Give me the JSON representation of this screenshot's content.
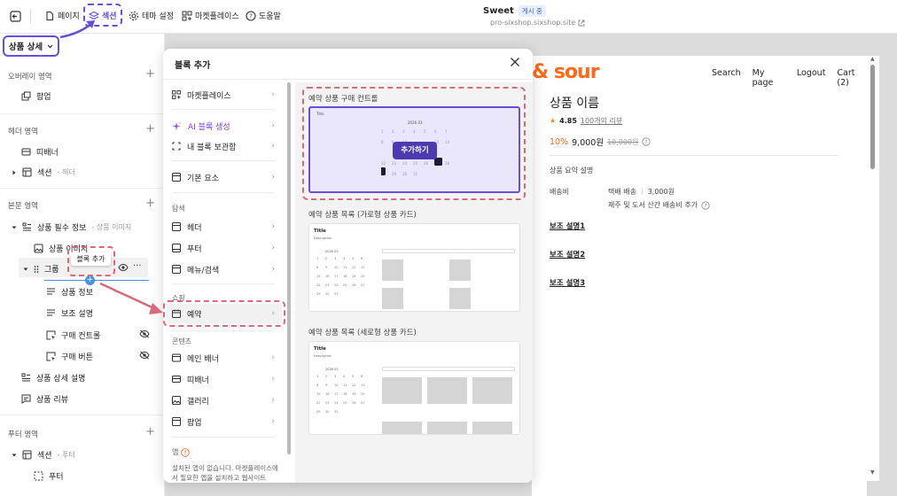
{
  "topbar": {
    "page_label": "페이지",
    "section_label": "섹션",
    "theme_label": "테마 설정",
    "market_label": "마켓플레이스",
    "help_label": "도움말",
    "site_name": "Sweet",
    "site_status": "게시 중",
    "site_url": "pro-sixshop.sixshop.site"
  },
  "page_select": "상품 상세",
  "sidebar": {
    "overlay": {
      "title": "오버레이 영역",
      "items": [
        "팝업"
      ]
    },
    "header": {
      "title": "헤더 영역",
      "ribbon": "띠배너",
      "section": "섹션",
      "section_sub": "- 헤더"
    },
    "body": {
      "title": "본문 영역",
      "product_info": "상품 필수 정보",
      "product_info_sub": "- 상품 이미지",
      "product_image": "상품 이미지",
      "group": "그룹",
      "product_info2": "상품 정보",
      "sub_desc": "보조 설명",
      "buy_control": "구매 컨트롤",
      "buy_button": "구매 버튼",
      "detail_desc": "상품 상세 설명",
      "review": "상품 리뷰"
    },
    "footer": {
      "title": "푸터 영역",
      "section": "섹션",
      "section_sub": "- 푸터",
      "footer": "푸터"
    },
    "tooltip": "블록 추가"
  },
  "modal": {
    "title": "블록 추가",
    "menu": {
      "market": "마켓플레이스",
      "ai": "AI 블록 생성",
      "storage": "내 블록 보관함",
      "basic": "기본 요소",
      "cat_nav": "탐색",
      "header": "헤더",
      "footer": "푸터",
      "menu_search": "메뉴/검색",
      "cat_shop": "쇼핑",
      "reserve": "예약",
      "cat_content": "콘텐츠",
      "main_banner": "메인 배너",
      "ribbon": "띠배너",
      "gallery": "갤러리",
      "popup": "팝업",
      "cat_app": "앱",
      "app_note": "설치된 앱이 없습니다. 마켓플레이스에서 필요한 앱을 설치하고 웹사이트"
    },
    "previews": [
      {
        "title": "예약 상품 구매 컨트롤",
        "button": "추가하기",
        "month": "2026.03",
        "label": "Title"
      },
      {
        "title": "예약 상품 목록 (가로형 상품 카드)",
        "card_title": "Title",
        "card_desc": "Description",
        "month": "2026.03"
      },
      {
        "title": "예약 상품 목록 (세로형 상품 카드)",
        "card_title": "Title",
        "card_desc": "Description",
        "month": "2026.03"
      }
    ]
  },
  "shop": {
    "logo": "& sour",
    "nav": [
      "Search",
      "My page",
      "Logout",
      "Cart (2)"
    ],
    "product_name": "상품 이름",
    "rating": "4.85",
    "reviews": "100개의 리뷰",
    "discount": "10%",
    "price": "9,000원",
    "original_price": "10,000원",
    "summary": "상품 요약 설명",
    "shipping_label": "배송비",
    "shipping_type": "택배 배송",
    "shipping_fee": "3,000원",
    "shipping_extra": "제주 및 도서 산간 배송비 추가",
    "sub_desc": [
      "보조 설명1",
      "보조 설명2",
      "보조 설명3"
    ]
  },
  "colors": {
    "accent": "#6a4fd6",
    "dash": "#d76b7b",
    "orange": "#ff6a1a",
    "discount": "#ef6b1f"
  }
}
